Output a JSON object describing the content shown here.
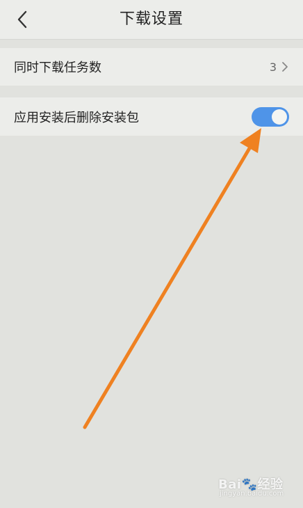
{
  "header": {
    "title": "下载设置",
    "back_icon": "chevron-left-icon"
  },
  "settings": [
    {
      "label": "同时下载任务数",
      "value": "3",
      "icon": "chevron-right-icon"
    },
    {
      "label": "应用安装后删除安装包",
      "toggle_on": true
    }
  ],
  "colors": {
    "background": "#e1e2de",
    "row_background": "#ecedea",
    "toggle_on": "#4f94e8",
    "annotation_arrow": "#ef8121"
  },
  "watermark": {
    "brand": "Bai",
    "brand_suffix": "经验",
    "url": "jingyan.baidu.com"
  }
}
